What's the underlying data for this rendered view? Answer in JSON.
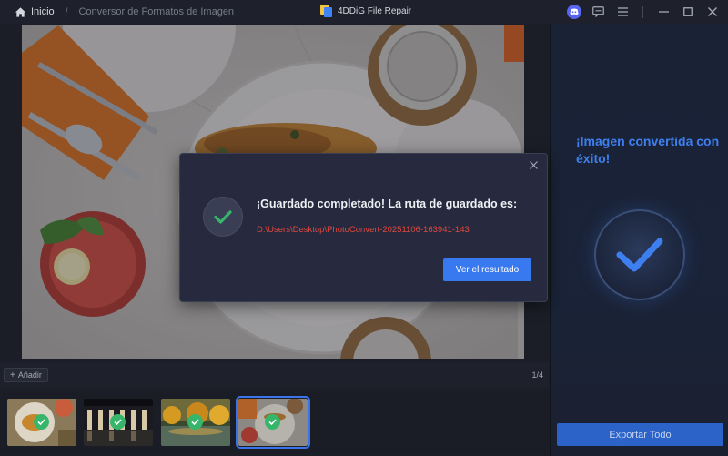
{
  "titlebar": {
    "home_label": "Inicio",
    "separator": "/",
    "section": "Conversor de Formatos de Imagen",
    "app_name": "4DDiG File Repair",
    "icons": [
      "discord-icon",
      "feedback-icon",
      "menu-icon",
      "minimize-icon",
      "maximize-icon",
      "close-icon"
    ]
  },
  "workspace": {
    "add_label": "Añadir",
    "page_count": "1/4"
  },
  "thumbnails": [
    {
      "name": "food-photo-1",
      "selected": false
    },
    {
      "name": "arches-photo",
      "selected": false
    },
    {
      "name": "autumn-lake-photo",
      "selected": false
    },
    {
      "name": "table-photo",
      "selected": true
    }
  ],
  "right_panel": {
    "success_message": "¡Imagen convertida con éxito!",
    "export_label": "Exportar Todo"
  },
  "modal": {
    "title": "¡Guardado completado! La ruta de guardado es:",
    "path": "D:\\Users\\Desktop\\PhotoConvert-20251106-163941-143",
    "view_label": "Ver el resultado"
  },
  "colors": {
    "accent": "#3979ef",
    "success": "#36b66b",
    "path_red": "#e2473d",
    "success_text": "#3e7ff0"
  }
}
